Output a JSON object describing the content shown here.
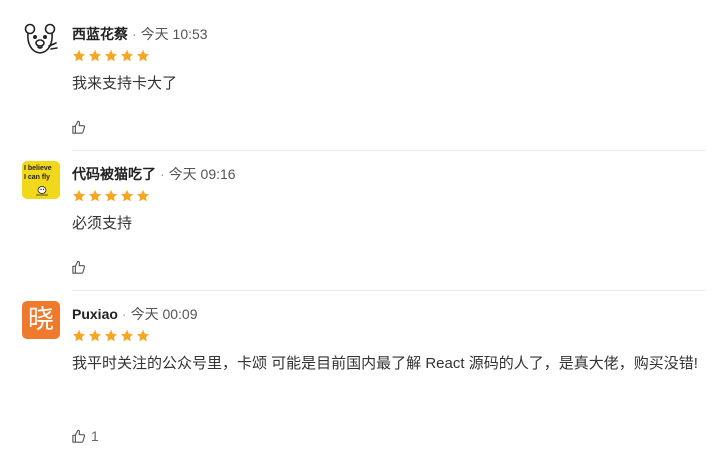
{
  "colors": {
    "star": "#f5a623",
    "avatar2_bg": "#f2d81b",
    "avatar3_bg": "#ef7a2e"
  },
  "comments": [
    {
      "avatar_icon": "bear-icon",
      "name": "西蓝花蔡",
      "separator": "·",
      "time": "今天 10:53",
      "rating": 5,
      "text": "我来支持卡大了",
      "likes": ""
    },
    {
      "avatar_icon": "i-believe-i-can-fly-avatar",
      "avatar_text_line1": "I believe",
      "avatar_text_line2": "I can fly",
      "name": "代码被猫吃了",
      "separator": "·",
      "time": "今天 09:16",
      "rating": 5,
      "text": "必须支持",
      "likes": ""
    },
    {
      "avatar_icon": "xiao-character-avatar",
      "avatar_char": "晓",
      "name": "Puxiao",
      "separator": "·",
      "time": "今天 00:09",
      "rating": 5,
      "text": "我平时关注的公众号里，卡颂 可能是目前国内最了解 React 源码的人了，是真大佬，购买没错!",
      "likes": "1"
    }
  ]
}
